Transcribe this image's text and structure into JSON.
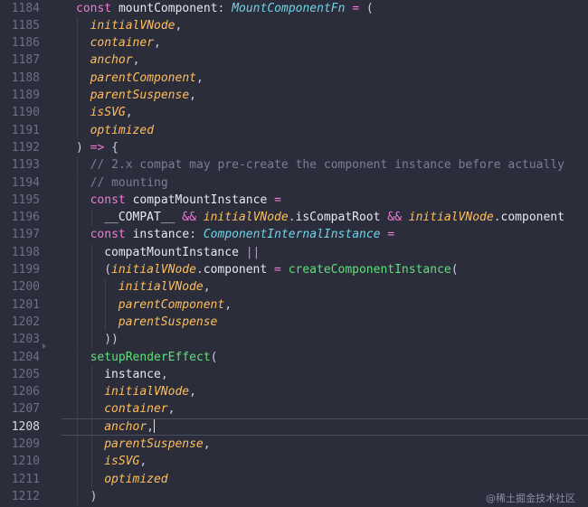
{
  "editor": {
    "current_line": "1208",
    "lines": [
      {
        "n": "1184",
        "indent": 0,
        "tokens": [
          [
            "kw",
            "const "
          ],
          [
            "name",
            "mountComponent"
          ],
          [
            "punc",
            ": "
          ],
          [
            "type",
            "MountComponentFn"
          ],
          [
            "op",
            " = "
          ],
          [
            "punc",
            "("
          ]
        ]
      },
      {
        "n": "1185",
        "indent": 1,
        "tokens": [
          [
            "param",
            "initialVNode"
          ],
          [
            "punc",
            ","
          ]
        ]
      },
      {
        "n": "1186",
        "indent": 1,
        "tokens": [
          [
            "param",
            "container"
          ],
          [
            "punc",
            ","
          ]
        ]
      },
      {
        "n": "1187",
        "indent": 1,
        "tokens": [
          [
            "param",
            "anchor"
          ],
          [
            "punc",
            ","
          ]
        ]
      },
      {
        "n": "1188",
        "indent": 1,
        "tokens": [
          [
            "param",
            "parentComponent"
          ],
          [
            "punc",
            ","
          ]
        ]
      },
      {
        "n": "1189",
        "indent": 1,
        "tokens": [
          [
            "param",
            "parentSuspense"
          ],
          [
            "punc",
            ","
          ]
        ]
      },
      {
        "n": "1190",
        "indent": 1,
        "tokens": [
          [
            "param",
            "isSVG"
          ],
          [
            "punc",
            ","
          ]
        ]
      },
      {
        "n": "1191",
        "indent": 1,
        "tokens": [
          [
            "param",
            "optimized"
          ]
        ]
      },
      {
        "n": "1192",
        "indent": 0,
        "tokens": [
          [
            "punc",
            ") "
          ],
          [
            "op",
            "=> "
          ],
          [
            "punc",
            "{"
          ]
        ]
      },
      {
        "n": "1193",
        "indent": 1,
        "tokens": [
          [
            "cmt",
            "// 2.x compat may pre-create the component instance before actually"
          ]
        ]
      },
      {
        "n": "1194",
        "indent": 1,
        "tokens": [
          [
            "cmt",
            "// mounting"
          ]
        ]
      },
      {
        "n": "1195",
        "indent": 1,
        "tokens": [
          [
            "kw",
            "const "
          ],
          [
            "name",
            "compatMountInstance"
          ],
          [
            "op",
            " ="
          ]
        ]
      },
      {
        "n": "1196",
        "indent": 2,
        "tokens": [
          [
            "plain",
            "__COMPAT__"
          ],
          [
            "op",
            " && "
          ],
          [
            "param",
            "initialVNode"
          ],
          [
            "punc",
            "."
          ],
          [
            "prop",
            "isCompatRoot"
          ],
          [
            "op",
            " && "
          ],
          [
            "param",
            "initialVNode"
          ],
          [
            "punc",
            "."
          ],
          [
            "prop",
            "component"
          ]
        ]
      },
      {
        "n": "1197",
        "indent": 1,
        "tokens": [
          [
            "kw",
            "const "
          ],
          [
            "name",
            "instance"
          ],
          [
            "punc",
            ": "
          ],
          [
            "type",
            "ComponentInternalInstance"
          ],
          [
            "op",
            " ="
          ]
        ]
      },
      {
        "n": "1198",
        "indent": 2,
        "tokens": [
          [
            "name",
            "compatMountInstance"
          ],
          [
            "op",
            " ||"
          ]
        ]
      },
      {
        "n": "1199",
        "indent": 2,
        "tokens": [
          [
            "punc",
            "("
          ],
          [
            "param",
            "initialVNode"
          ],
          [
            "punc",
            "."
          ],
          [
            "prop",
            "component"
          ],
          [
            "op",
            " = "
          ],
          [
            "fn",
            "createComponentInstance"
          ],
          [
            "punc",
            "("
          ]
        ]
      },
      {
        "n": "1200",
        "indent": 3,
        "tokens": [
          [
            "param",
            "initialVNode"
          ],
          [
            "punc",
            ","
          ]
        ]
      },
      {
        "n": "1201",
        "indent": 3,
        "tokens": [
          [
            "param",
            "parentComponent"
          ],
          [
            "punc",
            ","
          ]
        ]
      },
      {
        "n": "1202",
        "indent": 3,
        "tokens": [
          [
            "param",
            "parentSuspense"
          ]
        ]
      },
      {
        "n": "1203",
        "indent": 2,
        "tokens": [
          [
            "punc",
            "))"
          ]
        ],
        "fold": true
      },
      {
        "n": "1204",
        "indent": 1,
        "tokens": [
          [
            "fn",
            "setupRenderEffect"
          ],
          [
            "punc",
            "("
          ]
        ]
      },
      {
        "n": "1205",
        "indent": 2,
        "tokens": [
          [
            "name",
            "instance"
          ],
          [
            "punc",
            ","
          ]
        ]
      },
      {
        "n": "1206",
        "indent": 2,
        "tokens": [
          [
            "param",
            "initialVNode"
          ],
          [
            "punc",
            ","
          ]
        ]
      },
      {
        "n": "1207",
        "indent": 2,
        "tokens": [
          [
            "param",
            "container"
          ],
          [
            "punc",
            ","
          ]
        ]
      },
      {
        "n": "1208",
        "indent": 2,
        "tokens": [
          [
            "param",
            "anchor"
          ],
          [
            "punc",
            ","
          ]
        ],
        "active": true
      },
      {
        "n": "1209",
        "indent": 2,
        "tokens": [
          [
            "param",
            "parentSuspense"
          ],
          [
            "punc",
            ","
          ]
        ]
      },
      {
        "n": "1210",
        "indent": 2,
        "tokens": [
          [
            "param",
            "isSVG"
          ],
          [
            "punc",
            ","
          ]
        ]
      },
      {
        "n": "1211",
        "indent": 2,
        "tokens": [
          [
            "param",
            "optimized"
          ]
        ]
      },
      {
        "n": "1212",
        "indent": 1,
        "tokens": [
          [
            "punc",
            ")"
          ]
        ]
      }
    ]
  },
  "watermark": "@稀土掘金技术社区",
  "colors": {
    "background": "#2b2d3a",
    "keyword": "#f07ad8",
    "function": "#5fe07a",
    "type": "#6fd3e6",
    "parameter": "#ffbe5c",
    "comment": "#7a7f99"
  }
}
